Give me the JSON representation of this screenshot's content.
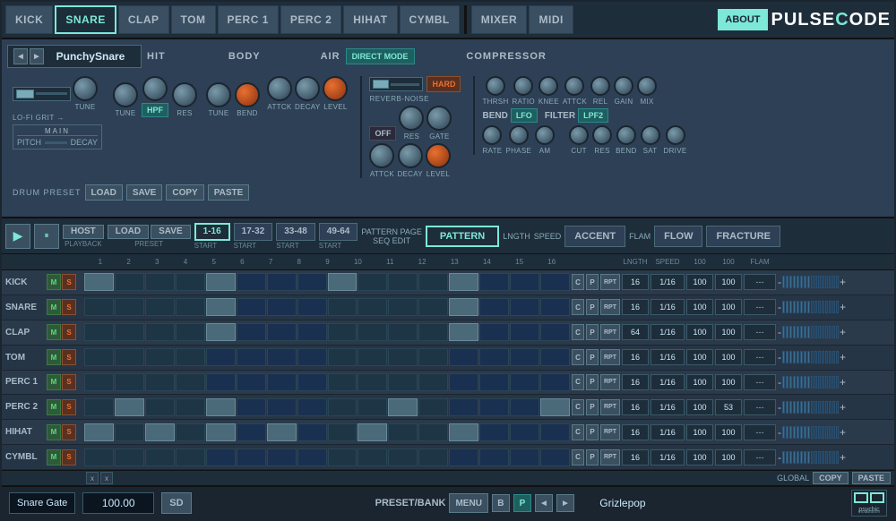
{
  "app": {
    "title": "PULSECODE",
    "about_label": "ABOUT"
  },
  "nav": {
    "items": [
      {
        "id": "kick",
        "label": "KICK",
        "active": false
      },
      {
        "id": "snare",
        "label": "SNARE",
        "active": true
      },
      {
        "id": "clap",
        "label": "CLAP",
        "active": false
      },
      {
        "id": "tom",
        "label": "TOM",
        "active": false
      },
      {
        "id": "perc1",
        "label": "PERC 1",
        "active": false
      },
      {
        "id": "perc2",
        "label": "PERC 2",
        "active": false
      },
      {
        "id": "hihat",
        "label": "HIHAT",
        "active": false
      },
      {
        "id": "cymbl",
        "label": "CYMBL",
        "active": false
      },
      {
        "id": "mixer",
        "label": "MIXER",
        "active": false
      },
      {
        "id": "midi",
        "label": "MIDI",
        "active": false
      }
    ]
  },
  "instrument_panel": {
    "preset_name": "PunchySnare",
    "sections": {
      "hit": {
        "title": "HIT",
        "knobs": [
          "TUNE",
          "HPF",
          "RES"
        ]
      },
      "body": {
        "title": "BODY",
        "knobs": [
          "TUNE",
          "BEND",
          "DECAY",
          "LEVEL"
        ]
      },
      "air": {
        "title": "AIR",
        "mode_btn": "DIRECT MODE",
        "hard_btn": "HARD",
        "slider_label": "REVERB-NOISE",
        "knobs": [
          "RES",
          "GATE",
          "ATTCK",
          "DECAY",
          "LEVEL"
        ]
      },
      "compressor": {
        "title": "COMPRESSOR",
        "knobs": [
          "THRSH",
          "RATIO",
          "KNEE",
          "ATTCK",
          "REL",
          "GAIN",
          "MIX"
        ]
      }
    },
    "lo_fi_label": "LO-FI GRIT →",
    "tune_label": "TUNE",
    "main_label": "MAIN",
    "pitch_label": "PITCH",
    "decay_label": "DECAY",
    "attck_label": "ATTCK",
    "level_label": "LEVEL",
    "drum_preset_label": "DRUM PRESET",
    "load_label": "LOAD",
    "save_label": "SAVE",
    "copy_label": "COPY",
    "paste_label": "PASTE",
    "bend_label": "BEND",
    "lfo_label": "LFO",
    "filter_label": "FILTER",
    "lpf2_label": "LPF2",
    "rate_label": "RATE",
    "phase_label": "PHASE",
    "am_label": "AM",
    "cut_label": "CUT",
    "res_label": "RES",
    "bend2_label": "BEND",
    "sat_label": "SAT",
    "drive_label": "DRIVE",
    "off_label": "OFF"
  },
  "sequencer": {
    "host_label": "HOST",
    "playback_label": "PLAYBACK",
    "load_label": "LOAD",
    "save_label": "SAVE",
    "preset_label": "PRESET",
    "pages": [
      "1-16",
      "17-32",
      "33-48",
      "49-64"
    ],
    "active_page": "1-16",
    "start_label": "START",
    "pattern_page_label": "PATTERN PAGE",
    "pattern_label": "PATTERN",
    "accent_label": "ACCENT",
    "flow_label": "FLOW",
    "fracture_label": "FRACTURE",
    "seq_edit_label": "SEQ EDIT",
    "lngth_label": "LNGTH",
    "speed_label": "SPEED",
    "flam_label": "FLAM",
    "rows": [
      {
        "name": "KICK",
        "lngth": "16",
        "speed": "1/16",
        "val1": "100",
        "val2": "100",
        "flam": "---",
        "cells": [
          1,
          0,
          0,
          0,
          1,
          0,
          0,
          0,
          1,
          0,
          0,
          0,
          1,
          0,
          0,
          0
        ]
      },
      {
        "name": "SNARE",
        "lngth": "16",
        "speed": "1/16",
        "val1": "100",
        "val2": "100",
        "flam": "---",
        "cells": [
          0,
          0,
          0,
          0,
          1,
          0,
          0,
          0,
          0,
          0,
          0,
          0,
          1,
          0,
          0,
          0
        ]
      },
      {
        "name": "CLAP",
        "lngth": "64",
        "speed": "1/16",
        "val1": "100",
        "val2": "100",
        "flam": "---",
        "cells": [
          0,
          0,
          0,
          0,
          1,
          0,
          0,
          0,
          0,
          0,
          0,
          0,
          1,
          0,
          0,
          0
        ]
      },
      {
        "name": "TOM",
        "lngth": "16",
        "speed": "1/16",
        "val1": "100",
        "val2": "100",
        "flam": "---",
        "cells": [
          0,
          0,
          0,
          0,
          0,
          0,
          0,
          0,
          0,
          0,
          0,
          0,
          0,
          0,
          0,
          0
        ]
      },
      {
        "name": "PERC 1",
        "lngth": "16",
        "speed": "1/16",
        "val1": "100",
        "val2": "100",
        "flam": "---",
        "cells": [
          0,
          0,
          0,
          0,
          0,
          0,
          0,
          0,
          0,
          0,
          0,
          0,
          0,
          0,
          0,
          0
        ]
      },
      {
        "name": "PERC 2",
        "lngth": "16",
        "speed": "1/16",
        "val1": "100",
        "val2": "53",
        "flam": "---",
        "cells": [
          0,
          1,
          0,
          0,
          1,
          0,
          0,
          0,
          0,
          0,
          1,
          0,
          0,
          0,
          0,
          1
        ]
      },
      {
        "name": "HIHAT",
        "lngth": "16",
        "speed": "1/16",
        "val1": "100",
        "val2": "100",
        "flam": "---",
        "cells": [
          1,
          0,
          1,
          0,
          1,
          0,
          1,
          0,
          0,
          1,
          0,
          0,
          1,
          0,
          0,
          0
        ]
      },
      {
        "name": "CYMBL",
        "lngth": "16",
        "speed": "1/16",
        "val1": "100",
        "val2": "100",
        "flam": "---",
        "cells": [
          0,
          0,
          0,
          0,
          0,
          0,
          0,
          0,
          0,
          0,
          0,
          0,
          0,
          0,
          0,
          0
        ]
      }
    ],
    "global_label": "GLOBAL",
    "copy_label": "COPY",
    "paste_label": "PASTE"
  },
  "status_bar": {
    "gate_label": "Snare Gate",
    "gate_value": "100.00",
    "sd_label": "SD",
    "preset_bank_label": "PRESET/BANK",
    "menu_label": "MENU",
    "b_label": "B",
    "p_label": "P",
    "bank_name": "Grizlepop",
    "copy_label": "COPY",
    "paste_label": "PASTE"
  }
}
